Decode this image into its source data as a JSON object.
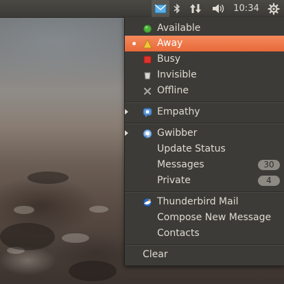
{
  "panel": {
    "clock": "10:34",
    "indicators": {
      "mail": "envelope-icon",
      "bluetooth": "bluetooth-icon",
      "network": "network-arrows-icon",
      "volume": "speaker-icon",
      "session": "gear-icon"
    }
  },
  "menu": {
    "status": [
      {
        "label": "Available",
        "icon": "green-dot-icon",
        "color": "#4caf3c"
      },
      {
        "label": "Away",
        "icon": "yellow-triangle-icon",
        "color": "#f2c53a",
        "selected": true
      },
      {
        "label": "Busy",
        "icon": "red-square-icon",
        "color": "#e0332b"
      },
      {
        "label": "Invisible",
        "icon": "invisible-icon"
      },
      {
        "label": "Offline",
        "icon": "offline-x-icon"
      }
    ],
    "empathy": {
      "label": "Empathy",
      "icon": "empathy-icon"
    },
    "gwibber": {
      "label": "Gwibber",
      "icon": "gwibber-icon",
      "items": [
        {
          "label": "Update Status"
        },
        {
          "label": "Messages",
          "count": "30"
        },
        {
          "label": "Private",
          "count": "4"
        }
      ]
    },
    "thunderbird": {
      "label": "Thunderbird Mail",
      "icon": "thunderbird-icon",
      "items": [
        {
          "label": "Compose New Message"
        },
        {
          "label": "Contacts"
        }
      ]
    },
    "clear": "Clear"
  },
  "colors": {
    "panel": "#3c3b37",
    "highlight": "#f07746",
    "menu_text": "#dfdbd2"
  }
}
